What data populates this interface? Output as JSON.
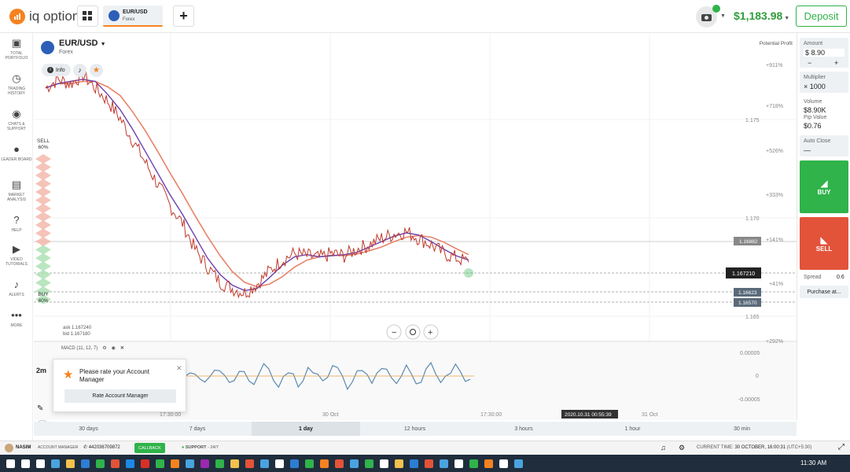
{
  "app": {
    "logo": "iq option"
  },
  "header": {
    "asset_tab": {
      "name": "EUR/USD",
      "type": "Forex"
    },
    "balance": "$1,183.98",
    "deposit": "Deposit"
  },
  "nav": [
    {
      "icon": "portfolio-icon",
      "label": "TOTAL PORTFOLIO"
    },
    {
      "icon": "history-icon",
      "label": "TRADING HISTORY"
    },
    {
      "icon": "chat-icon",
      "label": "CHATS & SUPPORT"
    },
    {
      "icon": "leaderboard-icon",
      "label": "LEADER BOARD"
    },
    {
      "icon": "market-icon",
      "label": "MARKET ANALYSIS"
    },
    {
      "icon": "help-icon",
      "label": "HELP"
    },
    {
      "icon": "video-icon",
      "label": "VIDEO TUTORIALS"
    },
    {
      "icon": "alerts-icon",
      "label": "ALERTS"
    },
    {
      "icon": "more-icon",
      "label": "MORE"
    }
  ],
  "asset": {
    "name": "EUR/USD",
    "type": "Forex",
    "info": "Info"
  },
  "sentiment": {
    "sell_label": "SELL",
    "sell_pct": "60%",
    "buy_label": "BUY",
    "buy_pct": "40%"
  },
  "potential_profit": "Potential Profit",
  "profit_levels": [
    "+911%",
    "+718%",
    "+526%",
    "+333%",
    "+141%",
    "+41%",
    "+292%"
  ],
  "price_axis": [
    "1.175",
    "1.170",
    "1.165"
  ],
  "price_tags": {
    "level1": "1.16882",
    "current": "1.167210",
    "level2": "1.16623",
    "level3": "1.16570"
  },
  "ask_bid": {
    "ask": "ask 1.167240",
    "bid": "bid 1.167180"
  },
  "macd": {
    "label": "MACD (11, 12, 7)",
    "axis": [
      "0.00005",
      "0",
      "-0.00005"
    ]
  },
  "time_axis": [
    "17:30:00",
    "30 Oct",
    "17:30:00",
    "31 Oct"
  ],
  "time_cursor": "2020.10.31 00:55:39",
  "timeframes": [
    "30 days",
    "7 days",
    "1 day",
    "12 hours",
    "3 hours",
    "1 hour",
    "30 min"
  ],
  "active_timeframe": "1 day",
  "side": {
    "interval": "2m",
    "counter": "5"
  },
  "right": {
    "amount_label": "Amount",
    "amount": "$ 8.90",
    "minus": "−",
    "plus": "+",
    "multiplier_label": "Multiplier",
    "multiplier": "× 1000",
    "volume_label": "Volume",
    "volume": "$8.90K",
    "pip_label": "Pip Value",
    "pip": "$0.76",
    "autoclose_label": "Auto Close",
    "autoclose": "—",
    "buy": "BUY",
    "sell": "SELL",
    "spread_label": "Spread",
    "spread": "0.6",
    "purchase": "Purchase at..."
  },
  "popup": {
    "text": "Please rate your Account Manager",
    "button": "Rate Account Manager"
  },
  "bottom": {
    "user": "NASIM",
    "manager_label": "ACCOUNT MANAGER",
    "phone": "442036709872",
    "callback": "CALLBACK",
    "support": "SUPPORT",
    "support_hours": "- 24/7",
    "current_time_label": "CURRENT TIME:",
    "current_time": "30 OCTOBER, 16:00:31",
    "timezone": "(UTC+5:30)"
  },
  "taskbar": {
    "time": "11:30 AM"
  },
  "colors": {
    "green": "#2fb34a",
    "red": "#e2533a",
    "orange": "#f58220",
    "price_line": "#c0392b",
    "ma_fast": "#6a3fb0",
    "ma_slow": "#e8836a"
  },
  "chart_data": {
    "type": "line",
    "price_series": [
      1.1752,
      1.1756,
      1.1754,
      1.1758,
      1.1752,
      1.1746,
      1.1738,
      1.1728,
      1.1718,
      1.1708,
      1.1698,
      1.169,
      1.1678,
      1.167,
      1.1663,
      1.166,
      1.1658,
      1.1662,
      1.1668,
      1.1673,
      1.1676,
      1.1675,
      1.1674,
      1.1676,
      1.1675,
      1.1678,
      1.168,
      1.1683,
      1.1685,
      1.1686,
      1.1683,
      1.168,
      1.1676,
      1.1674,
      1.1672
    ],
    "ylim": [
      1.164,
      1.177
    ]
  }
}
